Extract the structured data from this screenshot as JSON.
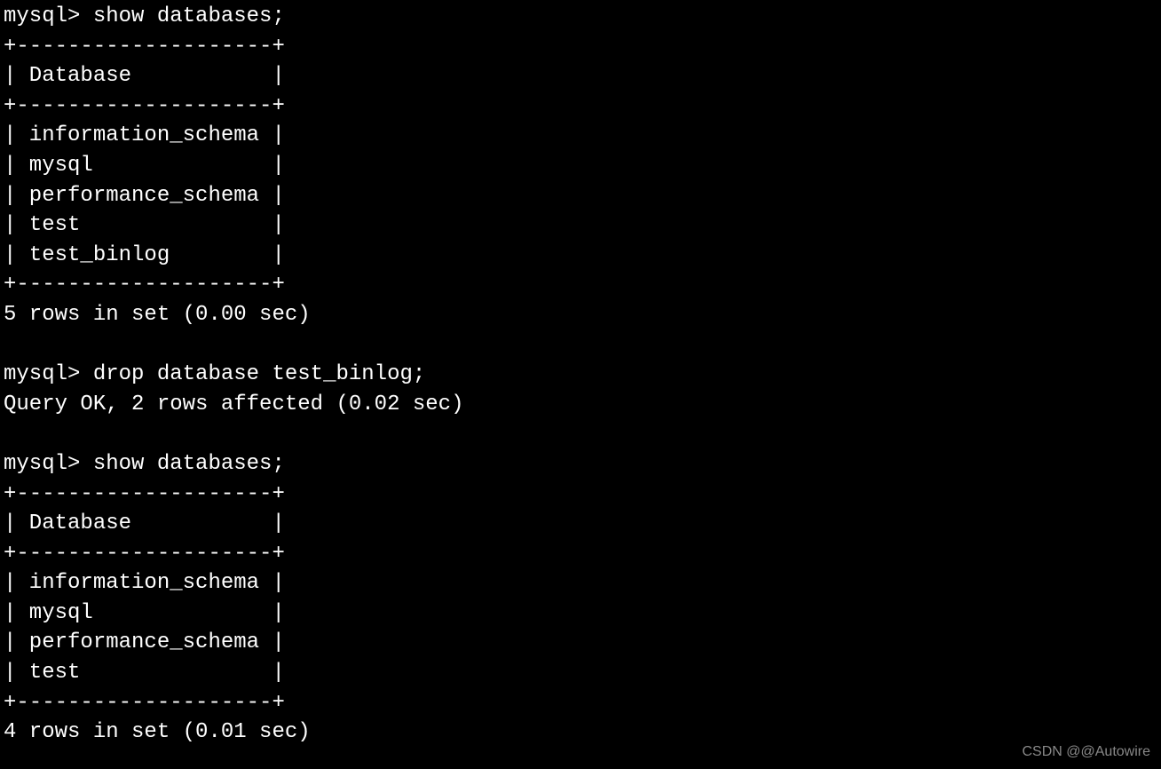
{
  "terminal": {
    "prompt": "mysql>",
    "commands": {
      "show_databases_1": "show databases;",
      "drop_database": "drop database test_binlog;",
      "show_databases_2": "show databases;"
    },
    "table1": {
      "border_top": "+--------------------+",
      "header": "| Database           |",
      "border_mid": "+--------------------+",
      "rows": [
        "| information_schema |",
        "| mysql              |",
        "| performance_schema |",
        "| test               |",
        "| test_binlog        |"
      ],
      "border_bottom": "+--------------------+",
      "summary": "5 rows in set (0.00 sec)"
    },
    "drop_result": "Query OK, 2 rows affected (0.02 sec)",
    "table2": {
      "border_top": "+--------------------+",
      "header": "| Database           |",
      "border_mid": "+--------------------+",
      "rows": [
        "| information_schema |",
        "| mysql              |",
        "| performance_schema |",
        "| test               |"
      ],
      "border_bottom": "+--------------------+",
      "summary": "4 rows in set (0.01 sec)"
    }
  },
  "watermark": "CSDN @@Autowire"
}
